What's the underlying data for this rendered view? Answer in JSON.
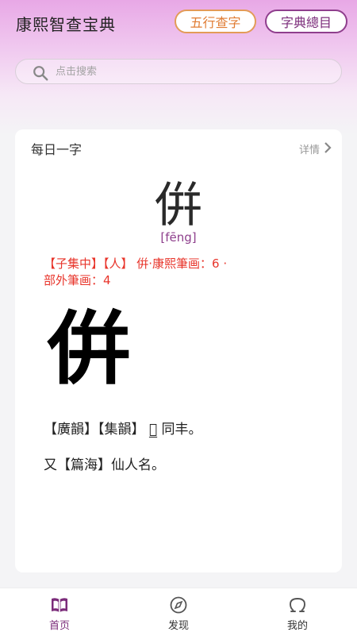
{
  "header": {
    "title": "康熙智查宝典",
    "wuxing_button": "五行查字",
    "index_button": "字典總目"
  },
  "search": {
    "placeholder": "点击搜索"
  },
  "daily": {
    "section_title": "每日一字",
    "detail_label": "详情",
    "character": "倂",
    "pinyin": "[fēng]",
    "meta_line1": "【子集中】【人】 倂·康熙筆画：6  ·",
    "meta_line2": "部外筆画：4",
    "calligraphy_char": "倂",
    "def1_prefix": "【廣韻】【集韻】",
    "def1_underlined": "𠑉",
    "def1_suffix": "同丰。",
    "def2": "又【篇海】仙人名。"
  },
  "tabs": [
    {
      "label": "首页",
      "icon": "book-icon",
      "active": true
    },
    {
      "label": "发现",
      "icon": "compass-icon",
      "active": false
    },
    {
      "label": "我的",
      "icon": "person-icon",
      "active": false
    }
  ],
  "colors": {
    "accent": "#7b2c7a",
    "orange": "#e07c33",
    "red": "#e8352b"
  }
}
